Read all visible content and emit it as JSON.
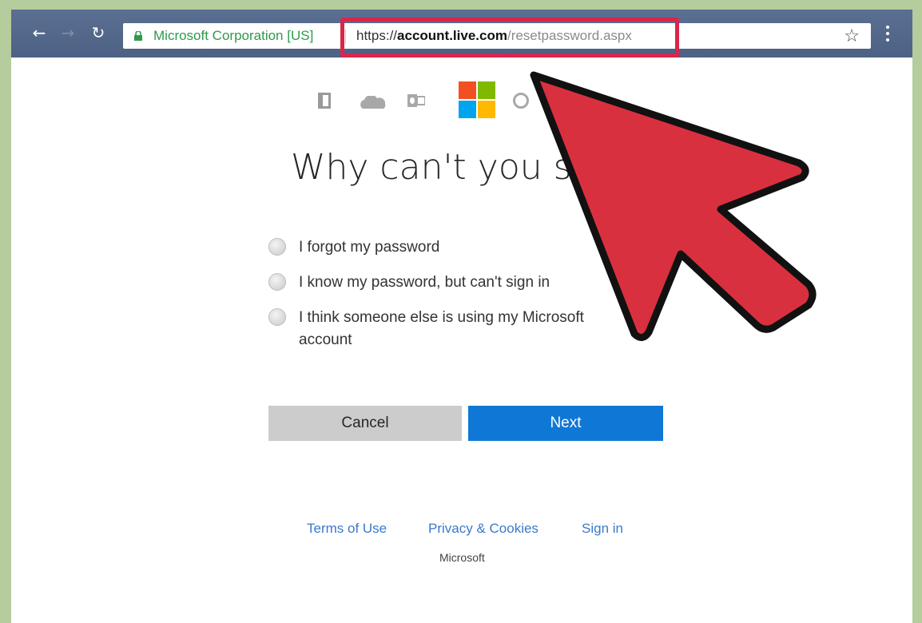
{
  "browser": {
    "site_identity": "Microsoft Corporation [US]",
    "url_scheme": "https://",
    "url_host": "account.live.com",
    "url_path": "/resetpassword.aspx",
    "nav_back_icon": "arrow-left-icon",
    "nav_forward_icon": "arrow-right-icon",
    "reload_icon": "reload-icon",
    "bookmark_icon": "star-icon",
    "menu_icon": "kebab-menu-icon",
    "highlight_color": "#d9264a"
  },
  "page": {
    "heading": "Why can't you sig",
    "options": [
      {
        "label": "I forgot my password"
      },
      {
        "label": "I know my password, but can't sign in"
      },
      {
        "label": "I think someone else is using my Microsoft account"
      }
    ],
    "cancel_label": "Cancel",
    "next_label": "Next",
    "footer": {
      "terms": "Terms of Use",
      "privacy": "Privacy & Cookies",
      "signin": "Sign in",
      "brand": "Microsoft"
    }
  },
  "colors": {
    "next_button": "#0f78d6",
    "cancel_button": "#cccccc",
    "link": "#3b7ac8",
    "arrow_fill": "#d9303f"
  }
}
